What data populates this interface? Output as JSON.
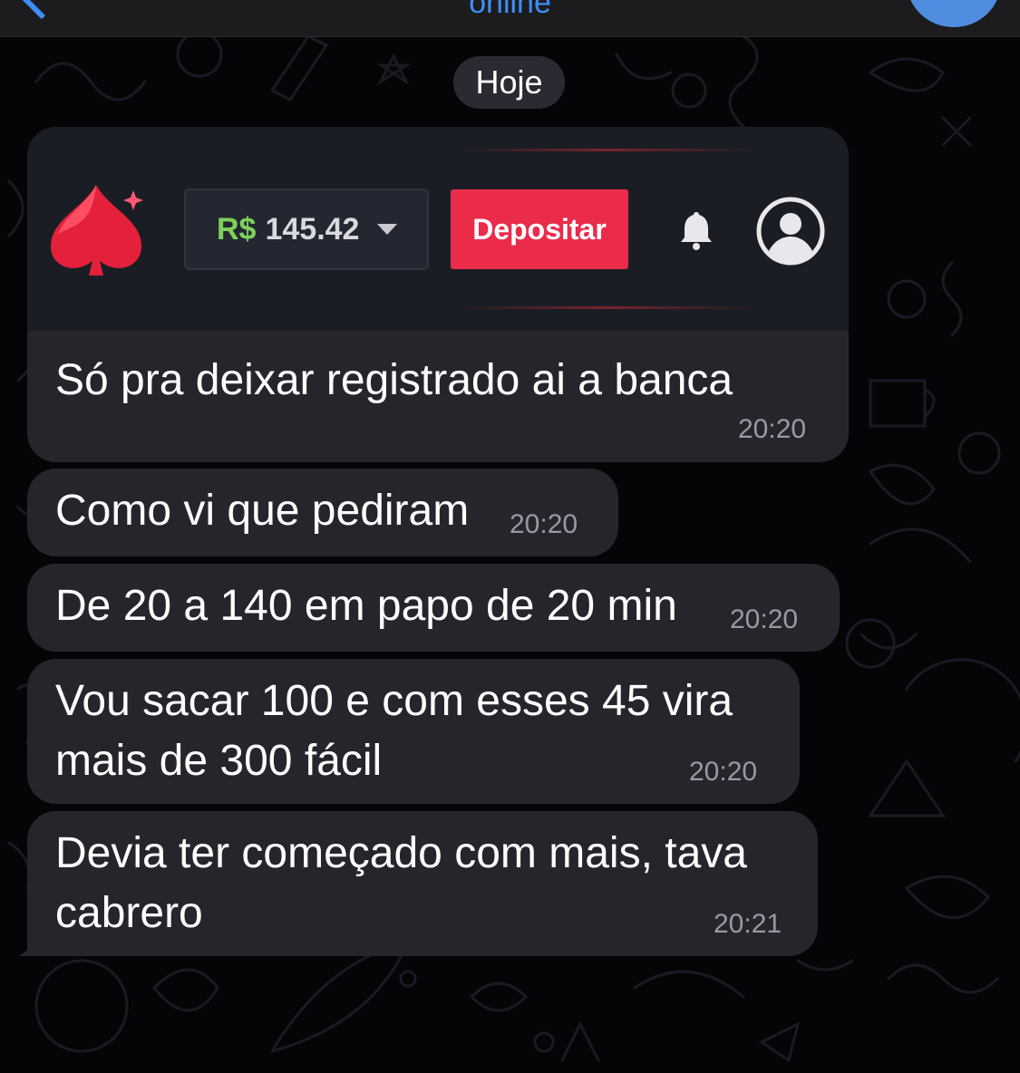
{
  "header": {
    "status": "online"
  },
  "date_separator": "Hoje",
  "screenshot_card": {
    "currency": "R$",
    "balance": "145.42",
    "deposit_label": "Depositar"
  },
  "messages": [
    {
      "text": "Só pra deixar registrado ai a banca",
      "time": "20:20"
    },
    {
      "text": "Como vi que pediram",
      "time": "20:20"
    },
    {
      "text": "De 20 a 140 em papo de 20 min",
      "time": "20:20"
    },
    {
      "text": "Vou sacar 100 e com esses 45 vira mais de 300 fácil",
      "time": "20:20"
    },
    {
      "text": "Devia ter começado com mais, tava cabrero",
      "time": "20:21"
    }
  ],
  "colors": {
    "accent_blue": "#3e8ef7",
    "bubble_bg": "#27252c",
    "deposit_red": "#ea2b4a",
    "currency_green": "#7ed15c"
  },
  "icons": [
    "back-chevron-icon",
    "spade-logo-icon",
    "dropdown-caret-icon",
    "bell-icon",
    "profile-icon"
  ]
}
